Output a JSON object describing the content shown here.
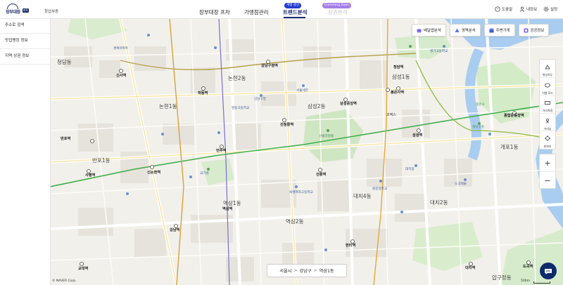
{
  "header": {
    "brand": "장부대장",
    "brand_badge": "파트너",
    "sub_label": "창업부동",
    "nav": [
      {
        "label": "장부대장 프차"
      },
      {
        "label": "가맹점관리"
      },
      {
        "label": "트렌드분석",
        "badge": "개발 중인"
      },
      {
        "label": "상권분석",
        "badge": "Comming Soon"
      }
    ],
    "utils": [
      {
        "label": "도움말",
        "icon": "help-icon"
      },
      {
        "label": "내정보",
        "icon": "user-icon"
      },
      {
        "label": "설정",
        "icon": "settings-icon"
      }
    ]
  },
  "sidebar": {
    "items": [
      {
        "label": "주소로 검색"
      },
      {
        "label": "맛집랭킹 정보"
      },
      {
        "label": "지역 상권 정보"
      }
    ]
  },
  "toolbar": {
    "buttons": [
      {
        "label": "배달앱분석",
        "icon": "delivery-icon",
        "color": "#7b5cf5"
      },
      {
        "label": "영역분석",
        "icon": "area-icon",
        "color": "#5c6df5"
      },
      {
        "label": "주변가게",
        "icon": "store-icon",
        "color": "#3f5bd9"
      },
      {
        "label": "공공정보",
        "icon": "public-info-icon",
        "color": "#7b5cf5"
      }
    ]
  },
  "right_panel": {
    "buttons": [
      {
        "label": "위성지도",
        "icon": "satellite-icon"
      },
      {
        "label": "지형 모드",
        "icon": "terrain-icon"
      },
      {
        "label": "거리측정",
        "icon": "ruler-icon"
      },
      {
        "label": "거리뷰",
        "icon": "streetview-icon"
      },
      {
        "label": "현위치",
        "icon": "location-icon"
      }
    ],
    "zoom_in": "+",
    "zoom_out": "−"
  },
  "breadcrumb": {
    "items": [
      "서울시",
      "강남구",
      "역삼1동"
    ],
    "separator": ">"
  },
  "map": {
    "copyright": "© NAVER Corp.",
    "scale": "500m",
    "areas": [
      "논현1동",
      "논현2동",
      "삼성1동",
      "삼성2동",
      "청담동",
      "반포1동",
      "역삼1동",
      "역삼2동",
      "대치4동",
      "대치2동",
      "잠실7동",
      "개포1동",
      "압구정동"
    ],
    "stations": [
      "신사역",
      "학동역",
      "강남구청역",
      "선정릉역",
      "삼성중앙역",
      "삼성역",
      "청담역",
      "봉은사역",
      "선릉역",
      "역삼역",
      "강남역",
      "양재역",
      "신논현역",
      "언주역",
      "한티역",
      "대치역",
      "도곡역",
      "교대역",
      "잠원역",
      "반포역",
      "사평역",
      "논현역",
      "종합운동장역"
    ],
    "pois": [
      "서울세관",
      "코엑스",
      "선릉과정릉",
      "국기원",
      "강남구청",
      "봉은사",
      "도곡렉슬",
      "대치동",
      "청담공원",
      "휘문중학교",
      "경기고등학교",
      "영동고등학교",
      "숙명여자고등학교",
      "경복아파트"
    ]
  }
}
